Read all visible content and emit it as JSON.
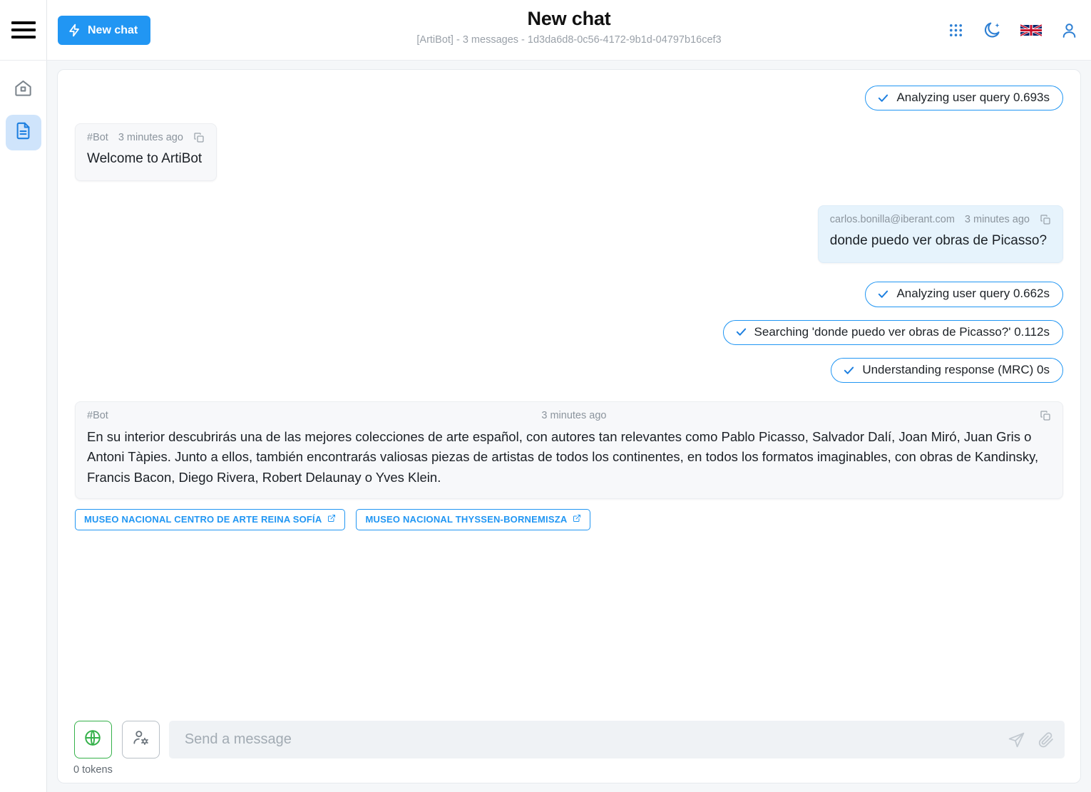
{
  "topbar": {
    "menu_icon": "hamburger-icon",
    "new_chat_label": "New chat",
    "new_chat_icon": "bolt-icon",
    "title": "New chat",
    "subtitle": "[ArtiBot] - 3 messages - 1d3da6d8-0c56-4172-9b1d-04797b16cef3",
    "icons": [
      {
        "name": "apps-grid-icon",
        "label": "Apps"
      },
      {
        "name": "dark-mode-moon-icon",
        "label": "Dark mode"
      },
      {
        "name": "language-flag-uk-icon",
        "label": "English"
      },
      {
        "name": "user-account-icon",
        "label": "Account"
      }
    ],
    "accent_color": "#2196f3"
  },
  "sidebar": {
    "items": [
      {
        "name": "sidebar-item-home",
        "icon": "home-icon",
        "active": false
      },
      {
        "name": "sidebar-item-documents",
        "icon": "document-icon",
        "active": true
      }
    ],
    "active_background": "#cfe4fb"
  },
  "conversation": [
    {
      "kind": "pill",
      "align": "right",
      "icon": "check-icon",
      "text": "Analyzing user query 0.693s"
    },
    {
      "kind": "message",
      "align": "left",
      "author": "#Bot",
      "timestamp": "3 minutes ago",
      "copy_icon": "copy-icon",
      "text": "Welcome to ArtiBot"
    },
    {
      "kind": "message",
      "align": "right",
      "author": "carlos.bonilla@iberant.com",
      "timestamp": "3 minutes ago",
      "copy_icon": "copy-icon",
      "text": "donde puedo ver obras de Picasso?"
    },
    {
      "kind": "pill",
      "align": "right",
      "icon": "check-icon",
      "text": "Analyzing user query 0.662s"
    },
    {
      "kind": "pill",
      "align": "right",
      "icon": "check-icon",
      "text": "Searching 'donde puedo ver obras de Picasso?' 0.112s"
    },
    {
      "kind": "pill",
      "align": "right",
      "icon": "check-icon",
      "text": "Understanding response (MRC) 0s"
    },
    {
      "kind": "message-wide",
      "align": "left",
      "author": "#Bot",
      "timestamp": "3 minutes ago",
      "copy_icon": "copy-icon",
      "text": "En su interior descubrirás una de las mejores colecciones de arte español, con autores tan relevantes como Pablo Picasso, Salvador Dalí, Joan Miró, Juan Gris o Antoni Tàpies. Junto a ellos, también encontrarás valiosas piezas de artistas de todos los continentes, en todos los formatos imaginables, con obras de Kandinsky, Francis Bacon, Diego Rivera, Robert Delaunay o Yves Klein.",
      "sources": [
        {
          "label": "MUSEO NACIONAL CENTRO DE ARTE REINA SOFÍA",
          "icon": "external-link-icon"
        },
        {
          "label": "MUSEO NACIONAL THYSSEN-BORNEMISZA",
          "icon": "external-link-icon"
        }
      ]
    }
  ],
  "messages": {
    "m0": {
      "text": "Analyzing user query 0.693s"
    },
    "m1": {
      "author": "#Bot",
      "timestamp": "3 minutes ago",
      "text": "Welcome to ArtiBot"
    },
    "m2": {
      "author": "carlos.bonilla@iberant.com",
      "timestamp": "3 minutes ago",
      "text": "donde puedo ver obras de Picasso?"
    },
    "m3": {
      "text": "Analyzing user query 0.662s"
    },
    "m4": {
      "text": "Searching 'donde puedo ver obras de Picasso?' 0.112s"
    },
    "m5": {
      "text": "Understanding response (MRC) 0s"
    },
    "m6": {
      "author": "#Bot",
      "timestamp": "3 minutes ago",
      "text": "En su interior descubrirás una de las mejores colecciones de arte español, con autores tan relevantes como Pablo Picasso, Salvador Dalí, Joan Miró, Juan Gris o Antoni Tàpies. Junto a ellos, también encontrarás valiosas piezas de artistas de todos los continentes, en todos los formatos imaginables, con obras de Kandinsky, Francis Bacon, Diego Rivera, Robert Delaunay o Yves Klein.",
      "source1": "MUSEO NACIONAL CENTRO DE ARTE REINA SOFÍA",
      "source2": "MUSEO NACIONAL THYSSEN-BORNEMISZA"
    }
  },
  "composer": {
    "globe_icon": "globe-icon",
    "persona_icon": "person-settings-icon",
    "tokens_label": "0 tokens",
    "input_value": "",
    "input_placeholder": "Send a message",
    "send_icon": "send-plane-icon",
    "attach_icon": "paperclip-icon",
    "globe_color": "#35b14a"
  }
}
